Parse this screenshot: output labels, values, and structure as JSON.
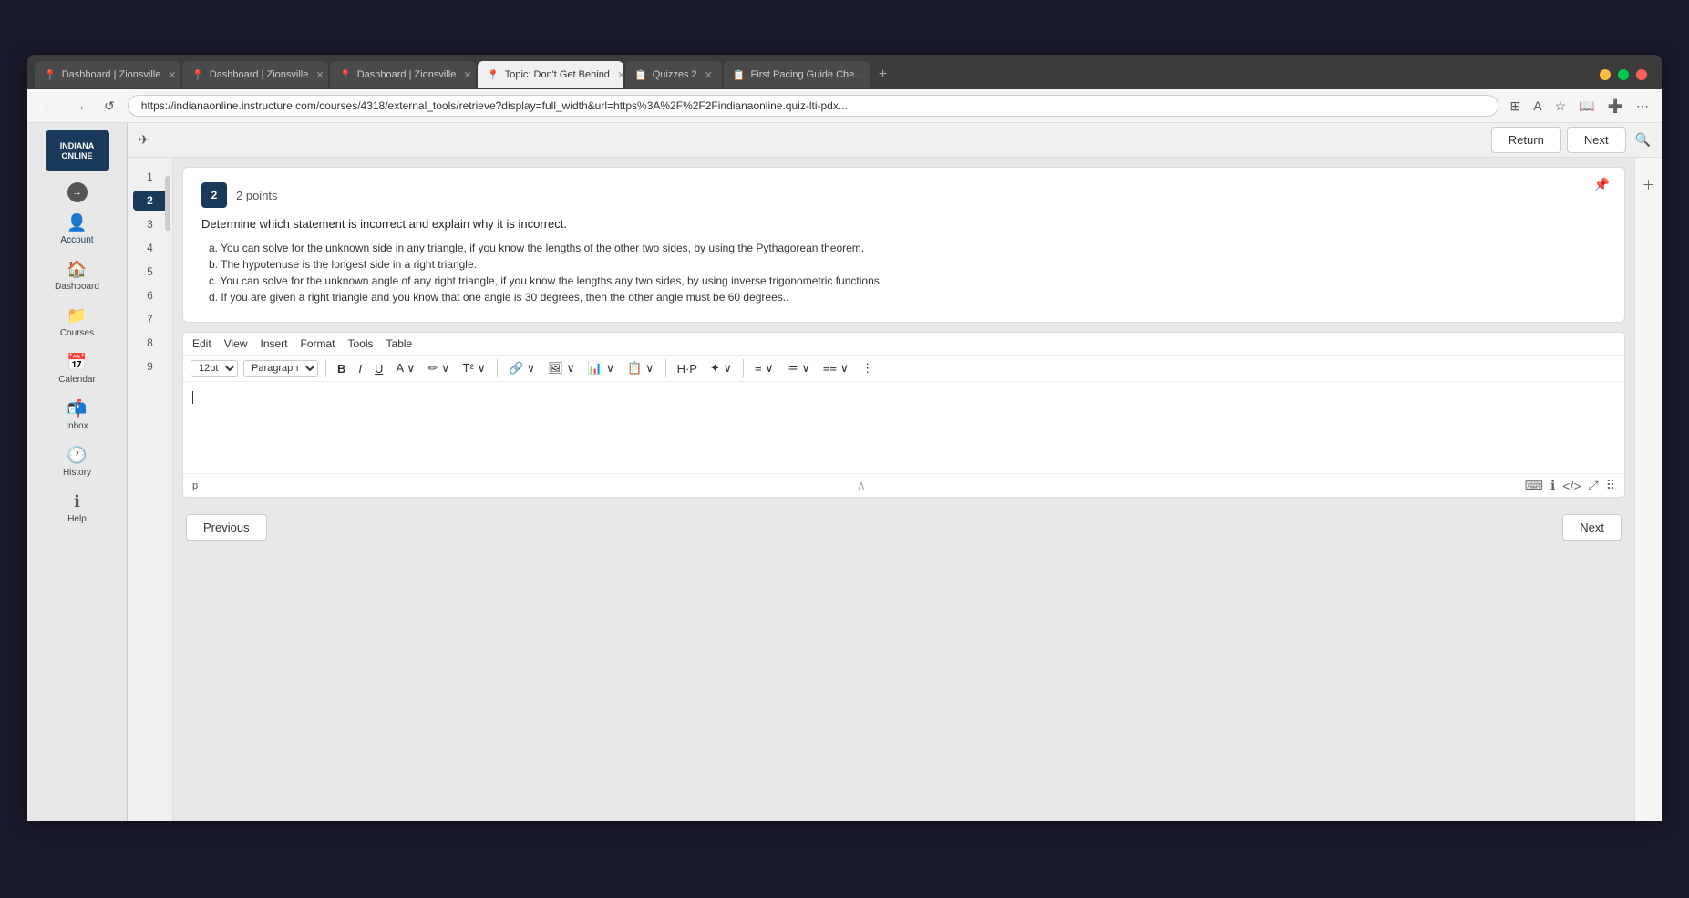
{
  "browser": {
    "tabs": [
      {
        "label": "Dashboard | Zionsville",
        "active": false,
        "icon": "📍"
      },
      {
        "label": "Dashboard | Zionsville",
        "active": false,
        "icon": "📍"
      },
      {
        "label": "Dashboard | Zionsville",
        "active": false,
        "icon": "📍"
      },
      {
        "label": "Topic: Don't Get Behind",
        "active": true,
        "icon": "📍"
      },
      {
        "label": "Quizzes 2",
        "active": false,
        "icon": "📋"
      },
      {
        "label": "First Pacing Guide Che...",
        "active": false,
        "icon": "📋"
      }
    ],
    "url": "https://indianaonline.instructure.com/courses/4318/external_tools/retrieve?display=full_width&url=https%3A%2F%2F2Findianaonline.quiz-lti-pdx...",
    "nav_back": "←",
    "nav_forward": "→",
    "nav_refresh": "↺"
  },
  "lms": {
    "logo_line1": "INDIANA",
    "logo_line2": "ONLINE",
    "nav_items": [
      {
        "id": "account",
        "label": "Account",
        "icon": "👤"
      },
      {
        "id": "dashboard",
        "label": "Dashboard",
        "icon": "🏠"
      },
      {
        "id": "courses",
        "label": "Courses",
        "icon": "📁"
      },
      {
        "id": "calendar",
        "label": "Calendar",
        "icon": "📅"
      },
      {
        "id": "inbox",
        "label": "Inbox",
        "icon": "📬"
      },
      {
        "id": "history",
        "label": "History",
        "icon": "🕐"
      },
      {
        "id": "help",
        "label": "Help",
        "icon": "ℹ"
      }
    ]
  },
  "toolbar": {
    "return_label": "Return",
    "next_label": "Next"
  },
  "question_numbers": [
    1,
    2,
    3,
    4,
    5,
    6,
    7,
    8,
    9
  ],
  "active_question": 2,
  "question": {
    "number": "2",
    "points": "2 points",
    "text": "Determine which statement is incorrect and explain why it is incorrect.",
    "options": [
      "a. You can solve for the unknown side in any triangle, if you know the lengths of the other two sides, by using the Pythagorean theorem.",
      "b. The hypotenuse is the longest side in a right triangle.",
      "c. You can solve for the unknown angle of any right triangle, if you know the lengths any two sides, by using inverse trigonometric functions.",
      "d. If you are given a right triangle and you know that one angle is 30 degrees, then the other angle must be 60 degrees.."
    ]
  },
  "editor": {
    "menus": [
      "Edit",
      "View",
      "Insert",
      "Format",
      "Tools",
      "Table"
    ],
    "font_size": "12pt",
    "paragraph": "Paragraph",
    "toolbar_buttons": [
      "B",
      "I",
      "U",
      "A",
      "✏",
      "T²",
      "🔗",
      "🖼",
      "📊",
      "📋",
      "H·P",
      "✦",
      "≡",
      "≔",
      "≡≡"
    ],
    "p_tag": "p",
    "footer_icons": [
      "⌨",
      "ℹ",
      "</>",
      "⤢",
      "⠿"
    ]
  },
  "bottom_nav": {
    "previous_label": "Previous",
    "next_label": "Next"
  }
}
